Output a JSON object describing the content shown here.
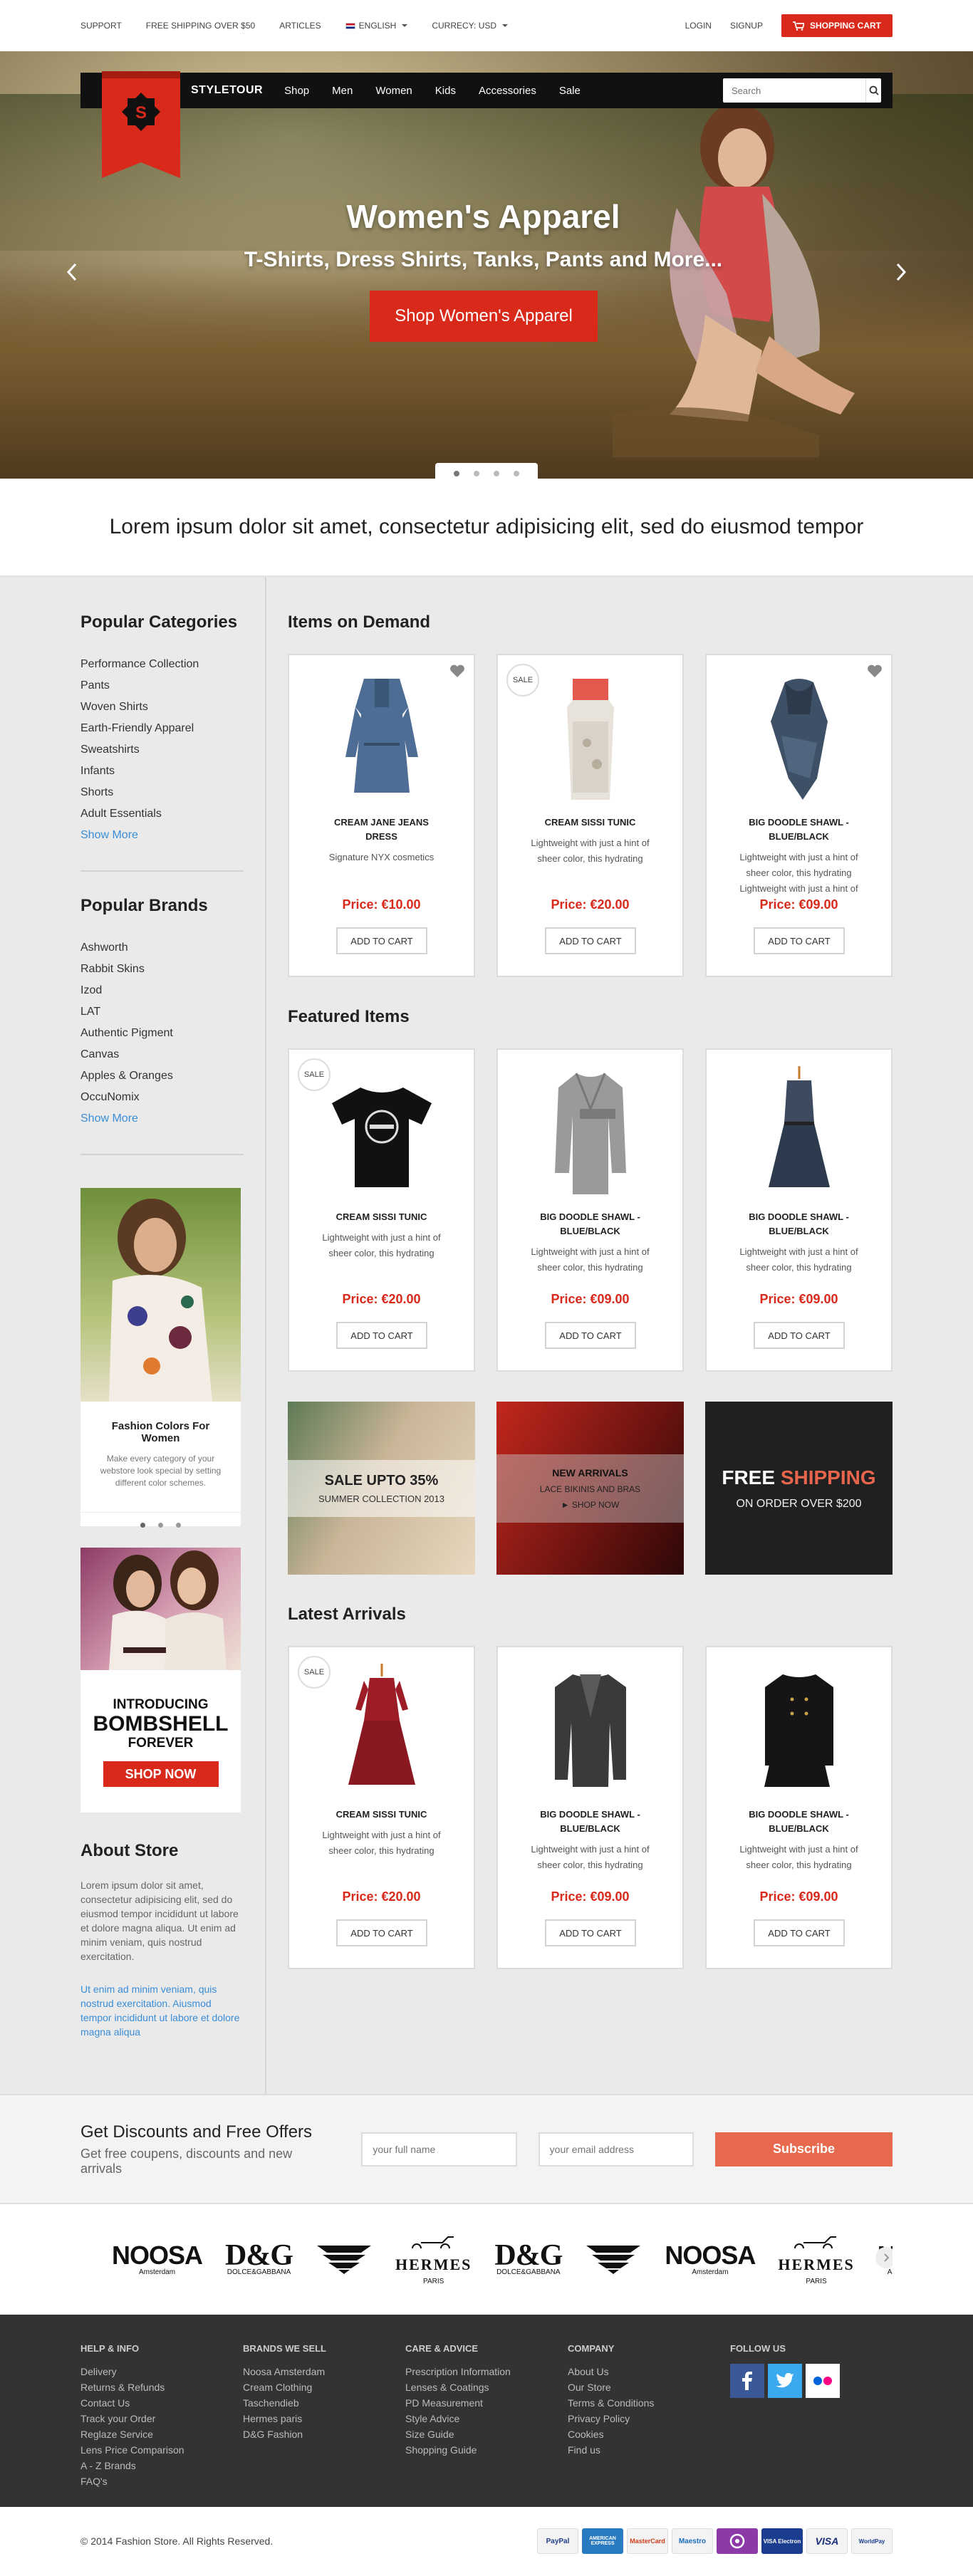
{
  "topbar": {
    "links": [
      "Support",
      "Free Shipping over $50",
      "Articles"
    ],
    "language": "English",
    "currency": "Currecy: USD",
    "login": "Login",
    "signup": "Signup",
    "cart": "Shopping Cart"
  },
  "nav": {
    "brand": "STYLETOUR",
    "logo_letter": "S",
    "items": [
      "Shop",
      "Men",
      "Women",
      "Kids",
      "Accessories",
      "Sale"
    ],
    "search_placeholder": "Search"
  },
  "hero": {
    "title": "Women's Apparel",
    "subtitle": "T-Shirts, Dress Shirts, Tanks, Pants and More...",
    "cta": "Shop Women's Apparel"
  },
  "tagline": "Lorem ipsum dolor sit amet, consectetur adipisicing elit, sed do eiusmod tempor",
  "sidebar": {
    "categories_title": "Popular Categories",
    "categories": [
      "Performance Collection",
      "Pants",
      "Woven Shirts",
      "Earth-Friendly Apparel",
      "Sweatshirts",
      "Infants",
      "Shorts",
      "Adult Essentials"
    ],
    "categories_more": "Show More",
    "brands_title": "Popular Brands",
    "brands": [
      "Ashworth",
      "Rabbit Skins",
      "Izod",
      "LAT",
      "Authentic Pigment",
      "Canvas",
      "Apples & Oranges",
      "OccuNomix"
    ],
    "brands_more": "Show More",
    "promo1": {
      "title": "Fashion Colors For Women",
      "desc": "Make every category of your webstore look special by setting different color schemes."
    },
    "promo2": {
      "l1": "INTRODUCING",
      "l2": "BOMBSHELL",
      "l3": "FOREVER",
      "button": "SHOP NOW"
    },
    "about_title": "About Store",
    "about_text": "Lorem ipsum dolor sit amet, consectetur adipisicing elit, sed do eiusmod tempor incididunt ut labore et dolore magna aliqua. Ut enim ad minim veniam, quis nostrud exercitation.",
    "about_link": "Ut enim ad minim veniam, quis nostrud exercitation. Aiusmod tempor incididunt ut labore et dolore magna aliqua"
  },
  "sections": {
    "demand": "Items on Demand",
    "featured": "Featured Items",
    "latest": "Latest Arrivals"
  },
  "badges": {
    "sale": "SALE",
    "add": "ADD TO CART"
  },
  "demand": [
    {
      "name": "Cream Jane Jeans Dress",
      "desc": "Signature NYX cosmetics",
      "price": "Price: €10.00"
    },
    {
      "name": "Cream Sissi Tunic",
      "desc": "Lightweight with just a hint of sheer color, this hydrating",
      "price": "Price: €20.00"
    },
    {
      "name": "Big Doodle Shawl - Blue/Black",
      "desc": "Lightweight with just a hint of sheer color, this hydrating Lightweight with just a hint of",
      "price": "Price: €09.00"
    }
  ],
  "featured": [
    {
      "name": "Cream Sissi Tunic",
      "desc": "Lightweight with just a hint of sheer color, this hydrating",
      "price": "Price: €20.00"
    },
    {
      "name": "Big Doodle Shawl - Blue/Black",
      "desc": "Lightweight with just a hint of sheer color, this hydrating",
      "price": "Price: €09.00"
    },
    {
      "name": "Big Doodle Shawl - Blue/Black",
      "desc": "Lightweight with just a hint of sheer color, this hydrating",
      "price": "Price: €09.00"
    }
  ],
  "latest": [
    {
      "name": "Cream Sissi Tunic",
      "desc": "Lightweight with just a hint of sheer color, this hydrating",
      "price": "Price: €20.00"
    },
    {
      "name": "Big Doodle Shawl - Blue/Black",
      "desc": "Lightweight with just a hint of sheer color, this hydrating",
      "price": "Price: €09.00"
    },
    {
      "name": "Big Doodle Shawl - Blue/Black",
      "desc": "Lightweight with just a hint of sheer color, this hydrating",
      "price": "Price: €09.00"
    }
  ],
  "banners": {
    "b1_title": "SALE UPTO 35%",
    "b1_sub": "SUMMER COLLECTION 2013",
    "b2_title": "NEW ARRIVALS",
    "b2_sub": "LACE BIKINIS AND BRAS",
    "b2_link": "► SHOP NOW",
    "b3_t1": "FREE",
    "b3_t2": "SHIPPING",
    "b3_sub": "ON ORDER OVER $200"
  },
  "newsletter": {
    "title": "Get Discounts and Free Offers",
    "sub": "Get free coupens, discounts and new arrivals",
    "name_ph": "your full name",
    "email_ph": "your email address",
    "button": "Subscribe"
  },
  "brand_logos": [
    {
      "n": "NOOSA",
      "s": "Amsterdam"
    },
    {
      "n": "D&G",
      "s": "DOLCE&GABBANA"
    },
    {
      "n": "",
      "s": ""
    },
    {
      "n": "HERMES",
      "s": "PARIS"
    },
    {
      "n": "D&G",
      "s": "DOLCE&GABBANA"
    },
    {
      "n": "",
      "s": ""
    },
    {
      "n": "NOOSA",
      "s": "Amsterdam"
    },
    {
      "n": "HERMES",
      "s": "PARIS"
    },
    {
      "n": "NOO",
      "s": "Amsterdam"
    }
  ],
  "footer": {
    "cols": [
      {
        "title": "Help & Info",
        "items": [
          "Delivery",
          "Returns & Refunds",
          "Contact Us",
          "Track your Order",
          "Reglaze Service",
          "Lens Price Comparison",
          "A - Z Brands",
          "FAQ's"
        ]
      },
      {
        "title": "Brands We Sell",
        "items": [
          "Noosa Amsterdam",
          "Cream Clothing",
          "Taschendieb",
          "Hermes paris",
          "D&G Fashion"
        ]
      },
      {
        "title": "Care & Advice",
        "items": [
          "Prescription Information",
          "Lenses & Coatings",
          "PD Measurement",
          "Style Advice",
          "Size Guide",
          "Shopping Guide"
        ]
      },
      {
        "title": "Company",
        "items": [
          "About Us",
          "Our Store",
          "Terms & Conditions",
          "Privacy Policy",
          "Cookies",
          "Find us"
        ]
      }
    ],
    "follow": "Follow Us",
    "copyright": "© 2014 Fashion Store. All Rights Reserved."
  },
  "payments": [
    "PayPal",
    "AMERICAN EXPRESS",
    "MasterCard",
    "Maestro",
    "",
    "VISA Electron",
    "VISA",
    "WorldPay"
  ],
  "colors": {
    "accent": "#d8291b",
    "subscribe": "#e86a4e",
    "link": "#3a8dd6",
    "footer": "#333333"
  }
}
